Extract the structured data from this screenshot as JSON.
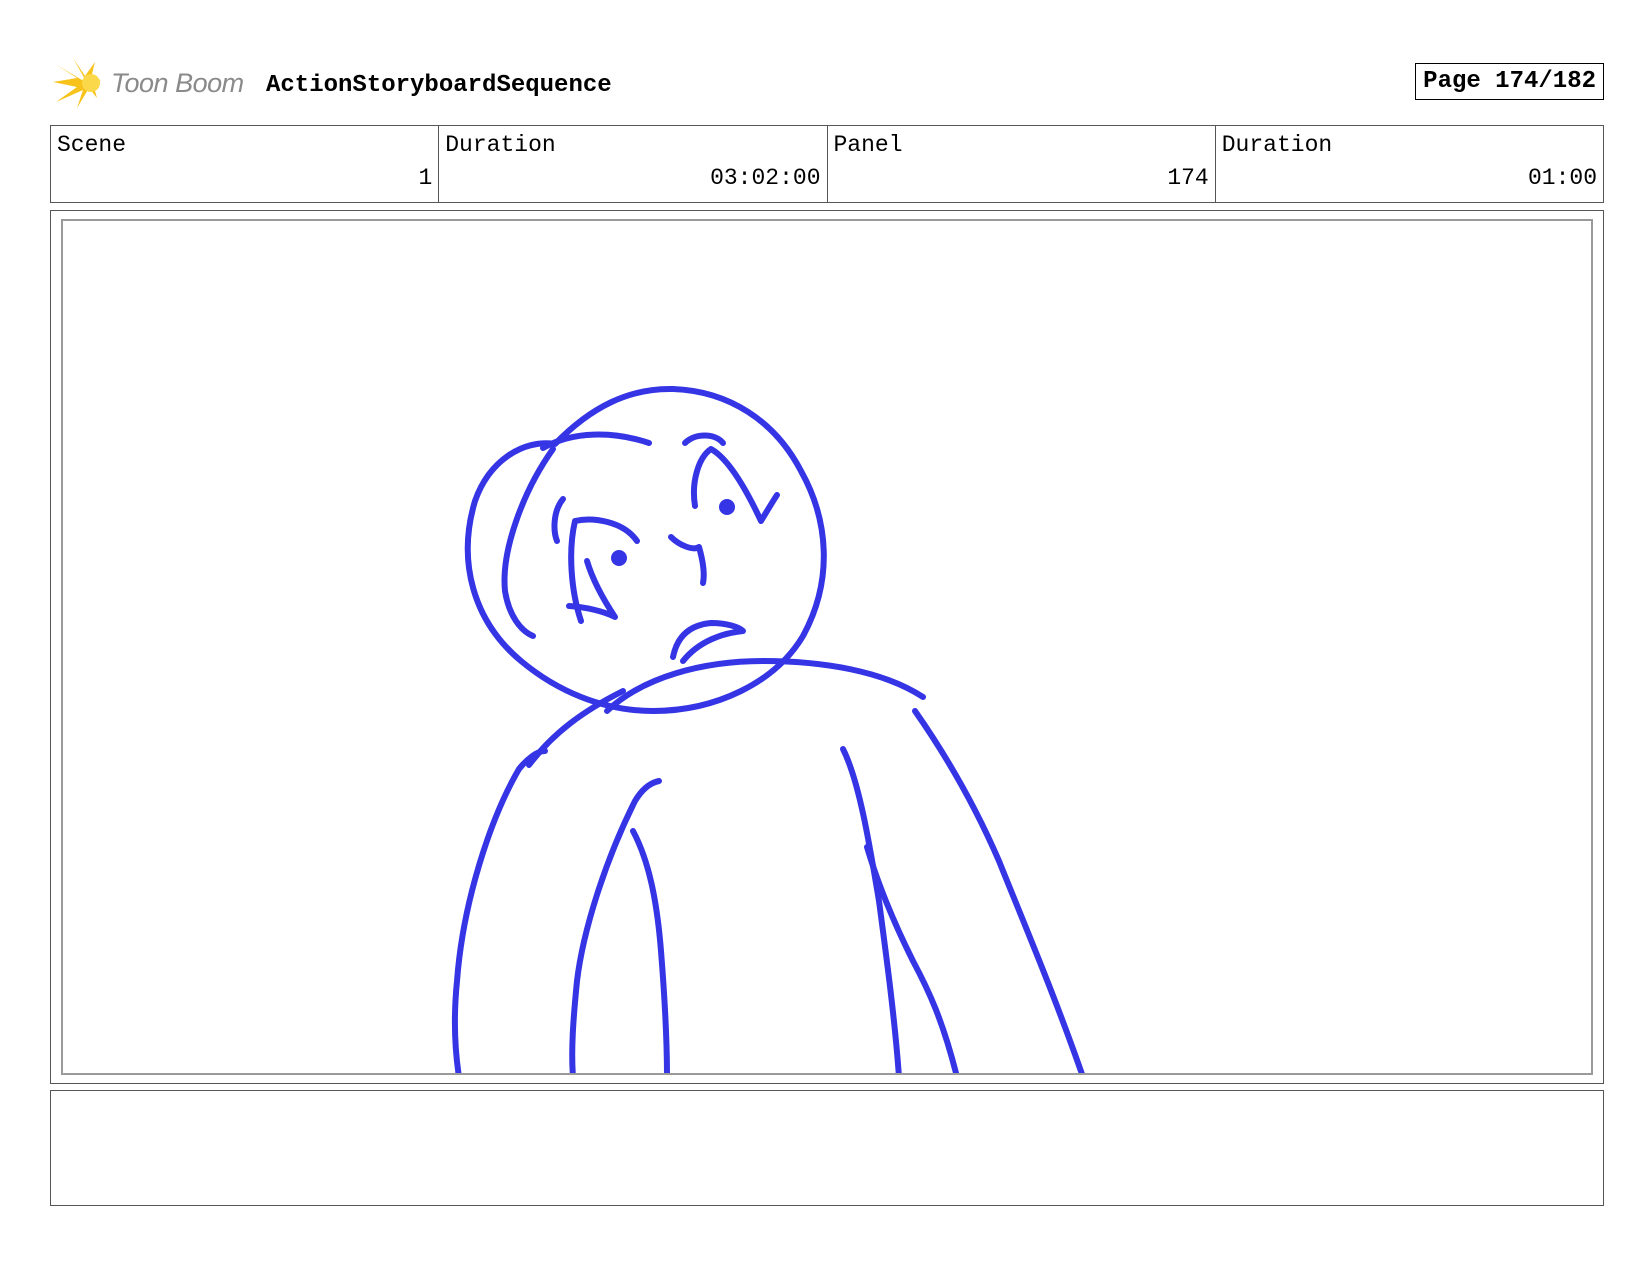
{
  "header": {
    "logo_text": "Toon Boom",
    "sequence_title": "ActionStoryboardSequence",
    "page_label": "Page 174/182"
  },
  "info": {
    "scene_label": "Scene",
    "scene_value": "1",
    "scene_duration_label": "Duration",
    "scene_duration_value": "03:02:00",
    "panel_label": "Panel",
    "panel_value": "174",
    "panel_duration_label": "Duration",
    "panel_duration_value": "01:00"
  },
  "sketch": {
    "stroke_color": "#3535e6"
  },
  "notes": {
    "text": ""
  }
}
